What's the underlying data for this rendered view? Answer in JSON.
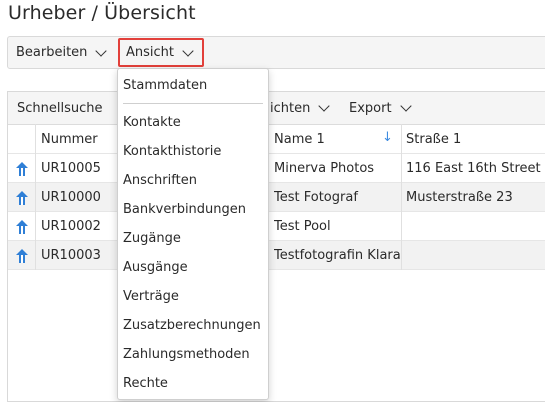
{
  "page": {
    "title": "Urheber / Übersicht"
  },
  "toolbar": {
    "edit_label": "Bearbeiten",
    "view_label": "Ansicht"
  },
  "subbar": {
    "quicksearch_label": "Schnellsuche",
    "views_label": "ichten",
    "export_label": "Export"
  },
  "table": {
    "columns": [
      "Nummer",
      "Name 1",
      "Straße 1"
    ],
    "rows": [
      {
        "number": "UR10005",
        "name1": "Minerva Photos",
        "street1": "116 East 16th Street"
      },
      {
        "number": "UR10000",
        "name1": "Test Fotograf",
        "street1": "Musterstraße 23"
      },
      {
        "number": "UR10002",
        "name1": "Test Pool",
        "street1": ""
      },
      {
        "number": "UR10003",
        "name1": "Testfotografin Klara",
        "street1": ""
      }
    ]
  },
  "view_menu": {
    "items": [
      "Stammdaten",
      "Kontakte",
      "Kontakthistorie",
      "Anschriften",
      "Bankverbindungen",
      "Zugänge",
      "Ausgänge",
      "Verträge",
      "Zusatzberechnungen",
      "Zahlungsmethoden",
      "Rechte"
    ]
  },
  "colors": {
    "highlight_border": "#e2403a",
    "row_icon": "#2f7fd6",
    "sort_arrow": "#3d8be0"
  }
}
